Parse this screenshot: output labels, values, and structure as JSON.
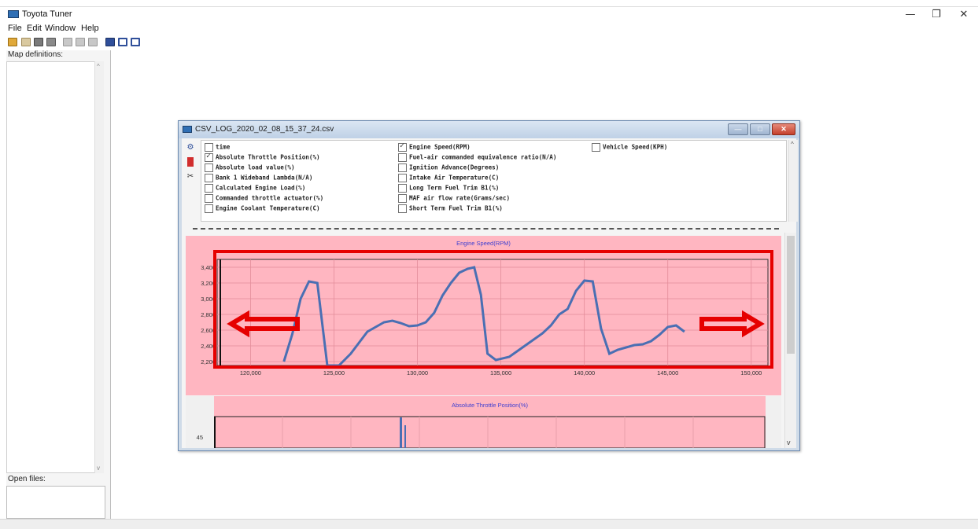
{
  "app": {
    "title": "Toyota Tuner",
    "window_controls": [
      "—",
      "❐",
      "✕"
    ]
  },
  "menu": [
    "File",
    "Edit",
    "Window",
    "Help"
  ],
  "toolbar_icons": [
    "open-folder-icon",
    "open-icon",
    "save-icon",
    "save-as-icon",
    "cut-icon",
    "copy-icon",
    "paste-icon",
    "compare-icon",
    "tile-icon",
    "cascade-icon"
  ],
  "left_panel": {
    "map_definitions_label": "Map definitions:",
    "open_files_label": "Open files:"
  },
  "child_window": {
    "title": "CSV_LOG_2020_02_08_15_37_24.csv",
    "channels_col1": [
      {
        "label": "time",
        "checked": false
      },
      {
        "label": "Absolute Throttle Position(%)",
        "checked": true
      },
      {
        "label": "Absolute load value(%)",
        "checked": false
      },
      {
        "label": "Bank 1 Wideband Lambda(N/A)",
        "checked": false
      },
      {
        "label": "Calculated Engine Load(%)",
        "checked": false
      },
      {
        "label": "Commanded throttle actuator(%)",
        "checked": false
      },
      {
        "label": "Engine Coolant Temperature(C)",
        "checked": false
      }
    ],
    "channels_col2": [
      {
        "label": "Engine Speed(RPM)",
        "checked": true
      },
      {
        "label": "Fuel-air commanded equivalence ratio(N/A)",
        "checked": false
      },
      {
        "label": "Ignition Advance(Degrees)",
        "checked": false
      },
      {
        "label": "Intake Air Temperature(C)",
        "checked": false
      },
      {
        "label": "Long Term Fuel Trim B1(%)",
        "checked": false
      },
      {
        "label": "MAF air flow rate(Grams/sec)",
        "checked": false
      },
      {
        "label": "Short Term Fuel Trim B1(%)",
        "checked": false
      }
    ],
    "channels_col3": [
      {
        "label": "Vehicle Speed(KPH)",
        "checked": false
      }
    ]
  },
  "chart_data": [
    {
      "type": "line",
      "title": "Engine Speed(RPM)",
      "xlabel": "",
      "ylabel": "",
      "xlim": [
        118000,
        151000
      ],
      "ylim": [
        2150,
        3500
      ],
      "x_ticks": [
        "120,000",
        "125,000",
        "130,000",
        "135,000",
        "140,000",
        "145,000",
        "150,000"
      ],
      "y_ticks": [
        "3,400",
        "3,200",
        "3,000",
        "2,800",
        "2,600",
        "2,400",
        "2,200"
      ],
      "grid": true,
      "series": [
        {
          "x": [
            122000,
            122500,
            123000,
            123500,
            124000,
            124600,
            124700,
            125300,
            126000,
            127000,
            128000,
            128500,
            129000,
            129500,
            130000,
            130500,
            131000,
            131500,
            132000,
            132500,
            133000,
            133400,
            133800,
            134200,
            134700,
            135500,
            136500,
            137500,
            138000,
            138500,
            139000,
            139500,
            140000,
            140500,
            141000,
            141500,
            142000,
            143000,
            143500,
            144000,
            144500,
            145000,
            145500,
            146000
          ],
          "y": [
            2200,
            2550,
            3000,
            3220,
            3200,
            2150,
            2150,
            2150,
            2300,
            2580,
            2700,
            2720,
            2690,
            2650,
            2660,
            2700,
            2820,
            3040,
            3200,
            3330,
            3380,
            3400,
            3050,
            2300,
            2220,
            2260,
            2410,
            2560,
            2660,
            2800,
            2870,
            3100,
            3230,
            3220,
            2620,
            2300,
            2350,
            2410,
            2420,
            2460,
            2540,
            2640,
            2660,
            2580
          ]
        }
      ]
    },
    {
      "type": "line",
      "title": "Absolute Throttle Position(%)",
      "xlabel": "",
      "ylabel": "",
      "y_ticks": [
        "45"
      ],
      "grid": true,
      "series": []
    }
  ],
  "colors": {
    "plot_background": "#ffb6c1",
    "line": "#4a6fb3",
    "highlight": "#e60000",
    "plot_title": "#4040d0"
  }
}
